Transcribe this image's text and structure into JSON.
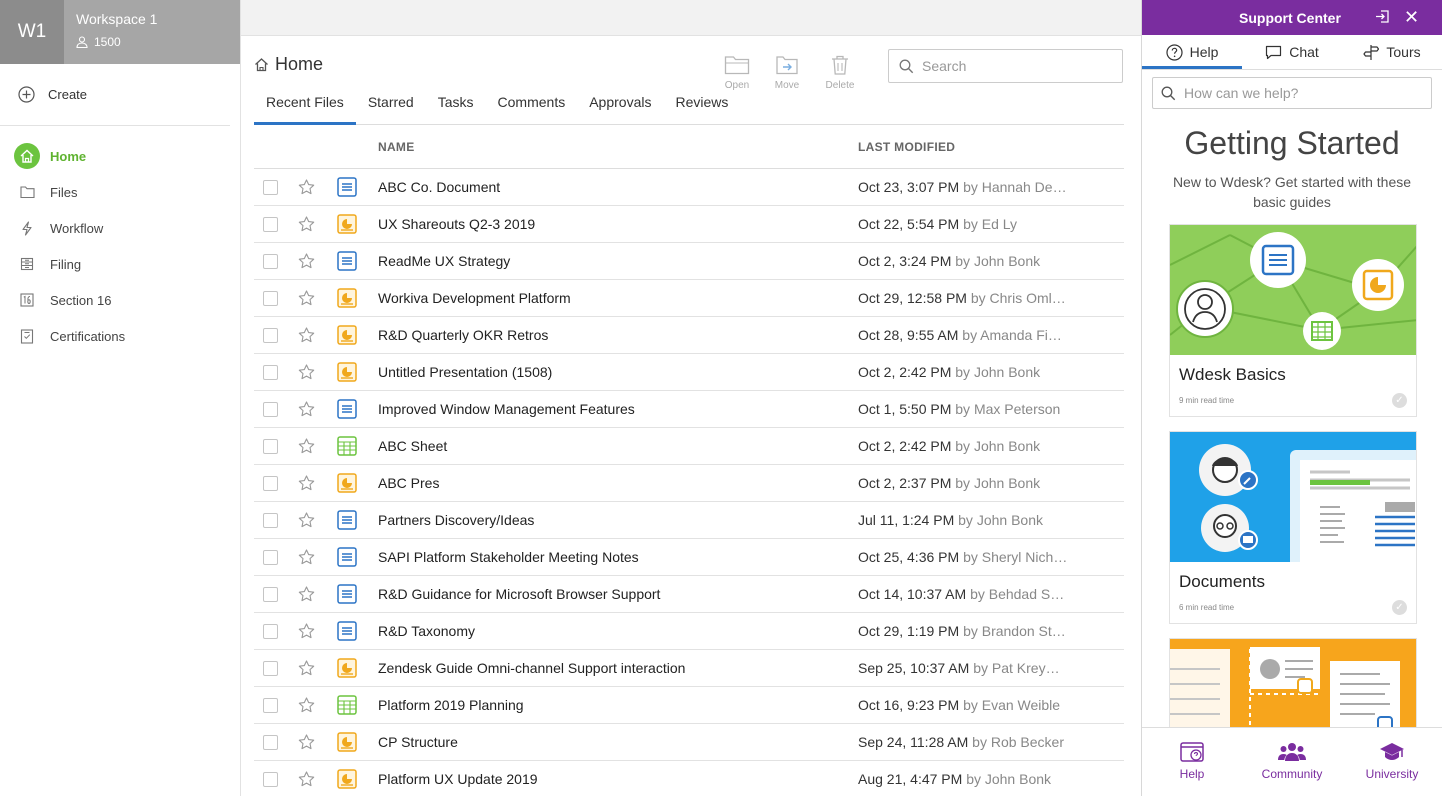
{
  "workspace": {
    "badge": "W1",
    "name": "Workspace 1",
    "users": "1500"
  },
  "sidebar": {
    "create_label": "Create",
    "items": [
      {
        "label": "Home",
        "icon": "home-icon",
        "active": true
      },
      {
        "label": "Files",
        "icon": "folder-icon"
      },
      {
        "label": "Workflow",
        "icon": "lightning-icon"
      },
      {
        "label": "Filing",
        "icon": "filing-icon"
      },
      {
        "label": "Section 16",
        "icon": "section16-icon"
      },
      {
        "label": "Certifications",
        "icon": "certification-icon"
      }
    ]
  },
  "main": {
    "title": "Home",
    "toolbar": {
      "open": "Open",
      "move": "Move",
      "delete": "Delete"
    },
    "search_placeholder": "Search",
    "tabs": [
      "Recent Files",
      "Starred",
      "Tasks",
      "Comments",
      "Approvals",
      "Reviews"
    ],
    "columns": {
      "name": "NAME",
      "modified": "LAST MODIFIED"
    },
    "rows": [
      {
        "type": "doc",
        "name": "ABC Co. Document",
        "date": "Oct 23, 3:07 PM",
        "by": "by Hannah De…"
      },
      {
        "type": "pres",
        "name": "UX Shareouts Q2-3 2019",
        "date": "Oct 22, 5:54 PM",
        "by": "by Ed Ly"
      },
      {
        "type": "doc",
        "name": "ReadMe UX Strategy",
        "date": "Oct 2, 3:24 PM",
        "by": "by John Bonk"
      },
      {
        "type": "pres",
        "name": "Workiva Development Platform",
        "date": "Oct 29, 12:58 PM",
        "by": "by Chris Oml…"
      },
      {
        "type": "pres",
        "name": "R&D Quarterly OKR Retros",
        "date": "Oct 28, 9:55 AM",
        "by": "by Amanda Fi…"
      },
      {
        "type": "pres",
        "name": "Untitled Presentation (1508)",
        "date": "Oct 2, 2:42 PM",
        "by": "by John Bonk"
      },
      {
        "type": "doc",
        "name": "Improved Window Management Features",
        "date": "Oct 1, 5:50 PM",
        "by": "by Max Peterson"
      },
      {
        "type": "sheet",
        "name": "ABC Sheet",
        "date": "Oct 2, 2:42 PM",
        "by": "by John Bonk"
      },
      {
        "type": "pres",
        "name": "ABC Pres",
        "date": "Oct 2, 2:37 PM",
        "by": "by John Bonk"
      },
      {
        "type": "doc",
        "name": "Partners Discovery/Ideas",
        "date": "Jul 11, 1:24 PM",
        "by": "by John Bonk"
      },
      {
        "type": "doc",
        "name": "SAPI Platform Stakeholder Meeting Notes",
        "date": "Oct 25, 4:36 PM",
        "by": "by Sheryl Nich…"
      },
      {
        "type": "doc",
        "name": "R&D Guidance for Microsoft Browser Support",
        "date": "Oct 14, 10:37 AM",
        "by": "by Behdad S…"
      },
      {
        "type": "doc",
        "name": "R&D Taxonomy",
        "date": "Oct 29, 1:19 PM",
        "by": "by Brandon St…"
      },
      {
        "type": "pres",
        "name": "Zendesk Guide Omni-channel Support interaction",
        "date": "Sep 25, 10:37 AM",
        "by": "by Pat Krey…"
      },
      {
        "type": "sheet",
        "name": "Platform 2019 Planning",
        "date": "Oct 16, 9:23 PM",
        "by": "by Evan Weible"
      },
      {
        "type": "pres",
        "name": "CP Structure",
        "date": "Sep 24, 11:28 AM",
        "by": "by Rob Becker"
      },
      {
        "type": "pres",
        "name": "Platform UX Update 2019",
        "date": "Aug 21, 4:47 PM",
        "by": "by John Bonk"
      }
    ]
  },
  "support": {
    "title": "Support Center",
    "tabs": {
      "help": "Help",
      "chat": "Chat",
      "tours": "Tours"
    },
    "search_placeholder": "How can we help?",
    "heading": "Getting Started",
    "subheading": "New to Wdesk? Get started with these basic guides",
    "cards": [
      {
        "title": "Wdesk Basics",
        "meta": "9 min read time"
      },
      {
        "title": "Documents",
        "meta": "6 min read time"
      }
    ],
    "footer": {
      "help": "Help",
      "community": "Community",
      "university": "University"
    }
  },
  "colors": {
    "accent_blue": "#2c74c5",
    "support_purple": "#7a2d9f",
    "active_green": "#6cc43f",
    "doc_blue": "#2c74c5",
    "pres_orange": "#f0a81c",
    "sheet_green": "#6cc43f"
  }
}
